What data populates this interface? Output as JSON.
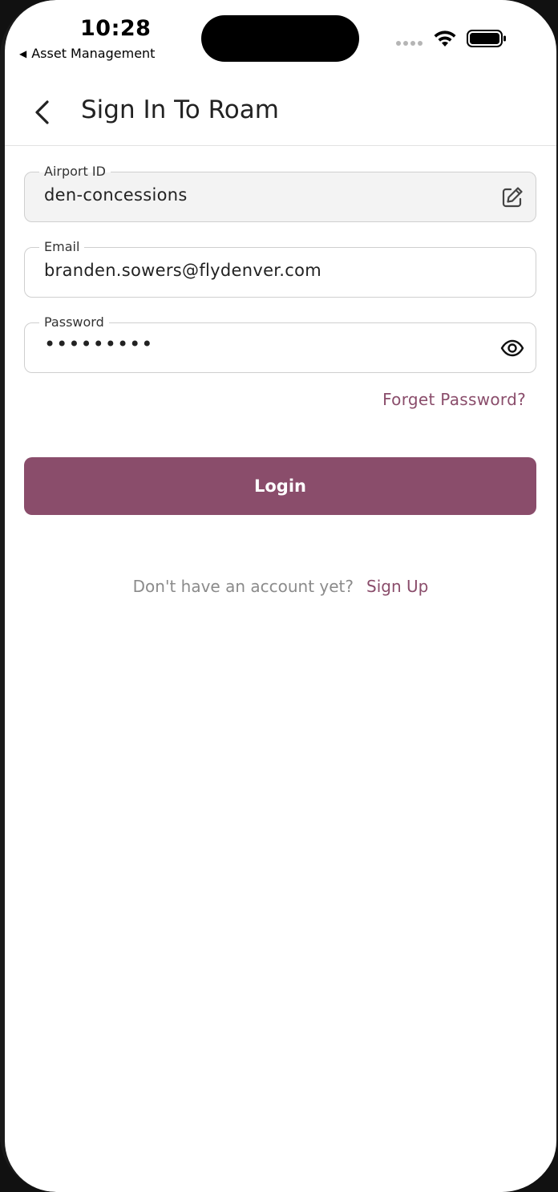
{
  "status_bar": {
    "time": "10:28",
    "back_app": "Asset Management",
    "back_icon": "back-triangle-icon",
    "signal_icon": "cellular-signal-icon",
    "wifi_icon": "wifi-icon",
    "battery_icon": "battery-icon"
  },
  "header": {
    "title": "Sign In To Roam",
    "back_icon": "chevron-left-icon"
  },
  "form": {
    "airport_id": {
      "label": "Airport ID",
      "value": "den-concessions",
      "icon": "edit-icon"
    },
    "email": {
      "label": "Email",
      "value": "branden.sowers@flydenver.com"
    },
    "password": {
      "label": "Password",
      "value": "•••••••••",
      "icon": "eye-icon"
    },
    "forgot_password": "Forget Password?",
    "login_label": "Login"
  },
  "footer": {
    "prompt": "Don't have an account yet?",
    "signup_label": "Sign Up"
  },
  "colors": {
    "accent": "#8a4d6b",
    "disabled_field_bg": "#f3f3f3"
  }
}
